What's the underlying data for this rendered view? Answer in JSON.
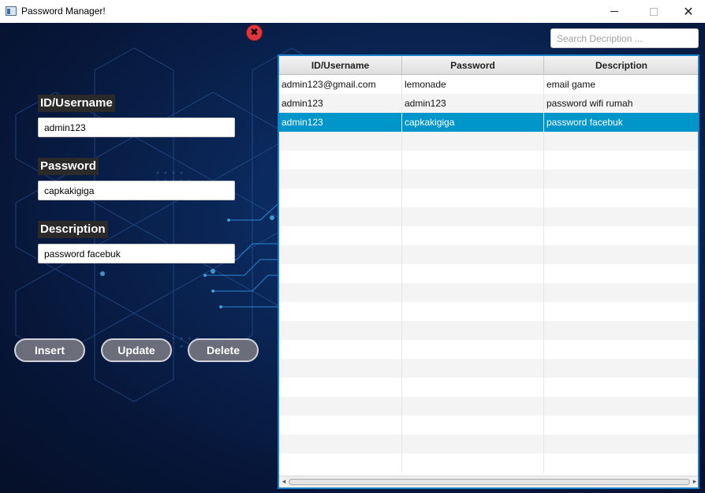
{
  "window": {
    "title": "Password Manager!",
    "controls": {
      "minimize": "—",
      "maximize": "☐",
      "close": "✕"
    }
  },
  "colors": {
    "accent": "#1b7ec9",
    "selected_row": "#0096c9",
    "close_button": "#e0383f",
    "button_bg": "#6b6e7a"
  },
  "form": {
    "close_symbol": "✖",
    "username": {
      "label": "ID/Username",
      "value": "admin123"
    },
    "password": {
      "label": "Password",
      "value": "capkakigiga"
    },
    "description": {
      "label": "Description",
      "value": "password facebuk"
    }
  },
  "buttons": {
    "insert": "Insert",
    "update": "Update",
    "delete": "Delete"
  },
  "search": {
    "placeholder": "Search Decription ..."
  },
  "table": {
    "columns": [
      "ID/Username",
      "Password",
      "Description"
    ],
    "rows": [
      [
        "admin123@gmail.com",
        "lemonade",
        "email game"
      ],
      [
        "admin123",
        "admin123",
        "password wifi rumah"
      ],
      [
        "admin123",
        "capkakigiga",
        "password facebuk"
      ]
    ],
    "selected_row": 2,
    "scroll_left_icon": "◂",
    "scroll_right_icon": "▸"
  }
}
